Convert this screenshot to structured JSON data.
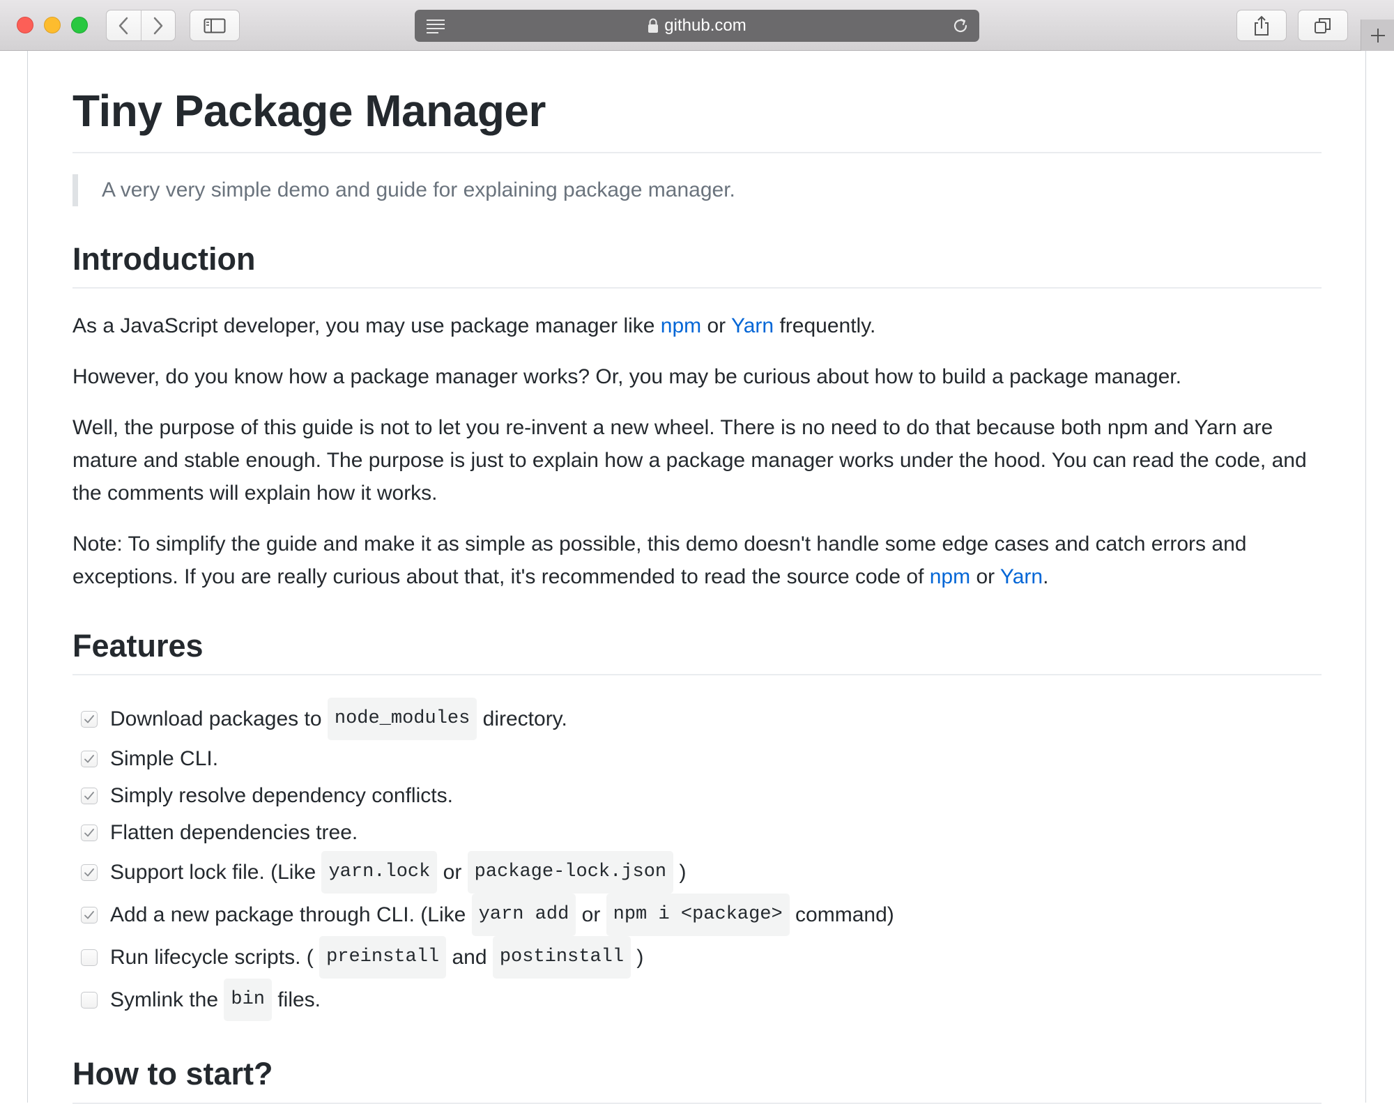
{
  "browser": {
    "url": "github.com",
    "colors": {
      "chrome": "#d3d1d3",
      "address_bar": "#6b6a6c"
    },
    "icons": [
      "back-arrow-icon",
      "forward-arrow-icon",
      "sidebar-icon",
      "reader-icon",
      "lock-icon",
      "reload-icon",
      "share-icon",
      "tabs-icon",
      "plus-icon"
    ]
  },
  "readme": {
    "title": "Tiny Package Manager",
    "tagline": "A very very simple demo and guide for explaining package manager.",
    "intro": {
      "heading": "Introduction",
      "p1_before": "As a JavaScript developer, you may use package manager like ",
      "p1_link1": "npm",
      "p1_mid": " or ",
      "p1_link2": "Yarn",
      "p1_after": " frequently.",
      "p2": "However, do you know how a package manager works? Or, you may be curious about how to build a package manager.",
      "p3": "Well, the purpose of this guide is not to let you re-invent a new wheel. There is no need to do that because both npm and Yarn are mature and stable enough. The purpose is just to explain how a package manager works under the hood. You can read the code, and the comments will explain how it works.",
      "p4_before": "Note: To simplify the guide and make it as simple as possible, this demo doesn't handle some edge cases and catch errors and exceptions. If you are really curious about that, it's recommended to read the source code of ",
      "p4_link1": "npm",
      "p4_mid": " or ",
      "p4_link2": "Yarn",
      "p4_after": "."
    },
    "features": {
      "heading": "Features",
      "items": [
        {
          "checked": true,
          "t1": "Download packages to ",
          "c1": "node_modules",
          "t2": " directory."
        },
        {
          "checked": true,
          "t1": "Simple CLI."
        },
        {
          "checked": true,
          "t1": "Simply resolve dependency conflicts."
        },
        {
          "checked": true,
          "t1": "Flatten dependencies tree."
        },
        {
          "checked": true,
          "t1": "Support lock file. (Like ",
          "c1": "yarn.lock",
          "t2": " or ",
          "c2": "package-lock.json",
          "t3": " )"
        },
        {
          "checked": true,
          "t1": "Add a new package through CLI. (Like ",
          "c1": "yarn add",
          "t2": " or ",
          "c2": "npm i <package>",
          "t3": " command)"
        },
        {
          "checked": false,
          "t1": "Run lifecycle scripts. ( ",
          "c1": "preinstall",
          "t2": " and ",
          "c2": "postinstall",
          "t3": " )"
        },
        {
          "checked": false,
          "t1": "Symlink the ",
          "c1": "bin",
          "t2": " files."
        }
      ]
    },
    "start": {
      "heading": "How to start?"
    },
    "colors": {
      "link": "#0366d6",
      "text": "#24292e",
      "muted": "#6a737d"
    }
  }
}
